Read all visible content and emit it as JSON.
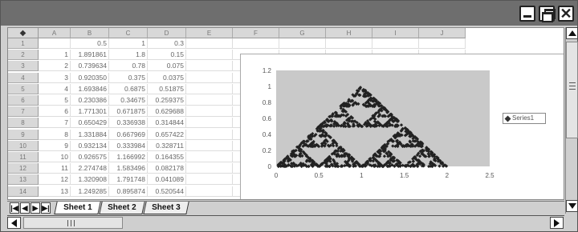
{
  "window": {
    "controls": {
      "minimize_icon": "minimize-icon",
      "restore_icon": "restore-icon",
      "close_icon": "close-icon",
      "close_glyph": "✕"
    }
  },
  "grid": {
    "corner_glyph": "◆",
    "columns": [
      "A",
      "B",
      "C",
      "D",
      "E",
      "F",
      "G",
      "H",
      "I",
      "J"
    ],
    "rows": [
      "1",
      "2",
      "3",
      "4",
      "5",
      "6",
      "7",
      "8",
      "9",
      "10",
      "11",
      "12",
      "13",
      "14"
    ],
    "cells": [
      [
        "",
        "0.5",
        "1",
        "0.3"
      ],
      [
        "1",
        "1.891861",
        "1.8",
        "0.15"
      ],
      [
        "2",
        "0.739634",
        "0.78",
        "0.075"
      ],
      [
        "3",
        "0.920350",
        "0.375",
        "0.0375"
      ],
      [
        "4",
        "1.693846",
        "0.6875",
        "0.51875"
      ],
      [
        "5",
        "0.230386",
        "0.34675",
        "0.259375"
      ],
      [
        "6",
        "1.771301",
        "0.671875",
        "0.629688"
      ],
      [
        "7",
        "0.650429",
        "0.336938",
        "0.314844"
      ],
      [
        "8",
        "1.331884",
        "0.667969",
        "0.657422"
      ],
      [
        "9",
        "0.932134",
        "0.333984",
        "0.328711"
      ],
      [
        "10",
        "0.926575",
        "1.166992",
        "0.164355"
      ],
      [
        "11",
        "2.274748",
        "1.583496",
        "0.082178"
      ],
      [
        "12",
        "1.320908",
        "1.791748",
        "0.041089"
      ],
      [
        "13",
        "1.249285",
        "0.895874",
        "0.520544"
      ]
    ]
  },
  "chart_data": {
    "type": "scatter",
    "xlim": [
      0,
      2.5
    ],
    "ylim": [
      0,
      1.2
    ],
    "x_ticks": [
      "0",
      "0.5",
      "1",
      "1.5",
      "2",
      "2.5"
    ],
    "y_ticks": [
      "0",
      "0.2",
      "0.4",
      "0.6",
      "0.8",
      "1",
      "1.2"
    ],
    "plot_area_color": "#c9c9c9",
    "marker_color": "#222222",
    "legend_position": "right",
    "series": [
      {
        "name": "Series1",
        "description_points": "Sierpinski triangle, vertices (0,0), (2,0), (1,1)"
      }
    ],
    "vertices": [
      [
        0,
        0
      ],
      [
        2,
        0
      ],
      [
        1,
        1
      ]
    ],
    "grid": false
  },
  "tabs": {
    "nav_glyphs": [
      "|◀",
      "◀",
      "▶",
      "▶|"
    ],
    "items": [
      "Sheet 1",
      "Sheet 2",
      "Sheet 3"
    ],
    "active": "Sheet 1"
  },
  "scrollbars": {
    "vertical_thumb_fraction": 0.55,
    "horizontal_thumb_fraction": 0.18
  }
}
